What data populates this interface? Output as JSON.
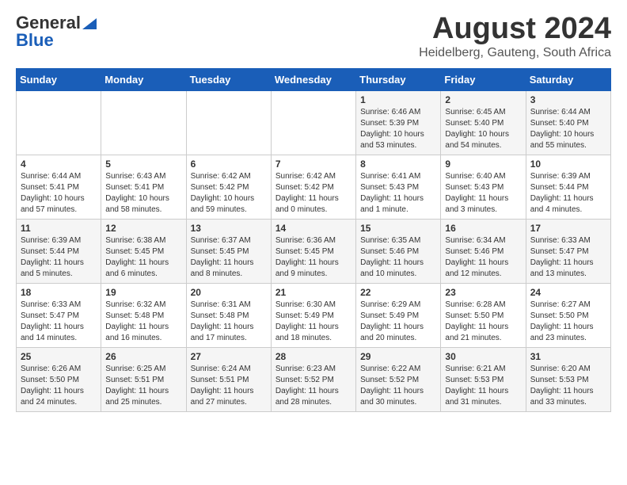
{
  "header": {
    "logo": {
      "general": "General",
      "blue": "Blue"
    },
    "title": "August 2024",
    "location": "Heidelberg, Gauteng, South Africa"
  },
  "calendar": {
    "days_header": [
      "Sunday",
      "Monday",
      "Tuesday",
      "Wednesday",
      "Thursday",
      "Friday",
      "Saturday"
    ],
    "weeks": [
      [
        {
          "day": "",
          "sunrise": "",
          "sunset": "",
          "daylight": ""
        },
        {
          "day": "",
          "sunrise": "",
          "sunset": "",
          "daylight": ""
        },
        {
          "day": "",
          "sunrise": "",
          "sunset": "",
          "daylight": ""
        },
        {
          "day": "",
          "sunrise": "",
          "sunset": "",
          "daylight": ""
        },
        {
          "day": "1",
          "sunrise": "Sunrise: 6:46 AM",
          "sunset": "Sunset: 5:39 PM",
          "daylight": "Daylight: 10 hours and 53 minutes."
        },
        {
          "day": "2",
          "sunrise": "Sunrise: 6:45 AM",
          "sunset": "Sunset: 5:40 PM",
          "daylight": "Daylight: 10 hours and 54 minutes."
        },
        {
          "day": "3",
          "sunrise": "Sunrise: 6:44 AM",
          "sunset": "Sunset: 5:40 PM",
          "daylight": "Daylight: 10 hours and 55 minutes."
        }
      ],
      [
        {
          "day": "4",
          "sunrise": "Sunrise: 6:44 AM",
          "sunset": "Sunset: 5:41 PM",
          "daylight": "Daylight: 10 hours and 57 minutes."
        },
        {
          "day": "5",
          "sunrise": "Sunrise: 6:43 AM",
          "sunset": "Sunset: 5:41 PM",
          "daylight": "Daylight: 10 hours and 58 minutes."
        },
        {
          "day": "6",
          "sunrise": "Sunrise: 6:42 AM",
          "sunset": "Sunset: 5:42 PM",
          "daylight": "Daylight: 10 hours and 59 minutes."
        },
        {
          "day": "7",
          "sunrise": "Sunrise: 6:42 AM",
          "sunset": "Sunset: 5:42 PM",
          "daylight": "Daylight: 11 hours and 0 minutes."
        },
        {
          "day": "8",
          "sunrise": "Sunrise: 6:41 AM",
          "sunset": "Sunset: 5:43 PM",
          "daylight": "Daylight: 11 hours and 1 minute."
        },
        {
          "day": "9",
          "sunrise": "Sunrise: 6:40 AM",
          "sunset": "Sunset: 5:43 PM",
          "daylight": "Daylight: 11 hours and 3 minutes."
        },
        {
          "day": "10",
          "sunrise": "Sunrise: 6:39 AM",
          "sunset": "Sunset: 5:44 PM",
          "daylight": "Daylight: 11 hours and 4 minutes."
        }
      ],
      [
        {
          "day": "11",
          "sunrise": "Sunrise: 6:39 AM",
          "sunset": "Sunset: 5:44 PM",
          "daylight": "Daylight: 11 hours and 5 minutes."
        },
        {
          "day": "12",
          "sunrise": "Sunrise: 6:38 AM",
          "sunset": "Sunset: 5:45 PM",
          "daylight": "Daylight: 11 hours and 6 minutes."
        },
        {
          "day": "13",
          "sunrise": "Sunrise: 6:37 AM",
          "sunset": "Sunset: 5:45 PM",
          "daylight": "Daylight: 11 hours and 8 minutes."
        },
        {
          "day": "14",
          "sunrise": "Sunrise: 6:36 AM",
          "sunset": "Sunset: 5:45 PM",
          "daylight": "Daylight: 11 hours and 9 minutes."
        },
        {
          "day": "15",
          "sunrise": "Sunrise: 6:35 AM",
          "sunset": "Sunset: 5:46 PM",
          "daylight": "Daylight: 11 hours and 10 minutes."
        },
        {
          "day": "16",
          "sunrise": "Sunrise: 6:34 AM",
          "sunset": "Sunset: 5:46 PM",
          "daylight": "Daylight: 11 hours and 12 minutes."
        },
        {
          "day": "17",
          "sunrise": "Sunrise: 6:33 AM",
          "sunset": "Sunset: 5:47 PM",
          "daylight": "Daylight: 11 hours and 13 minutes."
        }
      ],
      [
        {
          "day": "18",
          "sunrise": "Sunrise: 6:33 AM",
          "sunset": "Sunset: 5:47 PM",
          "daylight": "Daylight: 11 hours and 14 minutes."
        },
        {
          "day": "19",
          "sunrise": "Sunrise: 6:32 AM",
          "sunset": "Sunset: 5:48 PM",
          "daylight": "Daylight: 11 hours and 16 minutes."
        },
        {
          "day": "20",
          "sunrise": "Sunrise: 6:31 AM",
          "sunset": "Sunset: 5:48 PM",
          "daylight": "Daylight: 11 hours and 17 minutes."
        },
        {
          "day": "21",
          "sunrise": "Sunrise: 6:30 AM",
          "sunset": "Sunset: 5:49 PM",
          "daylight": "Daylight: 11 hours and 18 minutes."
        },
        {
          "day": "22",
          "sunrise": "Sunrise: 6:29 AM",
          "sunset": "Sunset: 5:49 PM",
          "daylight": "Daylight: 11 hours and 20 minutes."
        },
        {
          "day": "23",
          "sunrise": "Sunrise: 6:28 AM",
          "sunset": "Sunset: 5:50 PM",
          "daylight": "Daylight: 11 hours and 21 minutes."
        },
        {
          "day": "24",
          "sunrise": "Sunrise: 6:27 AM",
          "sunset": "Sunset: 5:50 PM",
          "daylight": "Daylight: 11 hours and 23 minutes."
        }
      ],
      [
        {
          "day": "25",
          "sunrise": "Sunrise: 6:26 AM",
          "sunset": "Sunset: 5:50 PM",
          "daylight": "Daylight: 11 hours and 24 minutes."
        },
        {
          "day": "26",
          "sunrise": "Sunrise: 6:25 AM",
          "sunset": "Sunset: 5:51 PM",
          "daylight": "Daylight: 11 hours and 25 minutes."
        },
        {
          "day": "27",
          "sunrise": "Sunrise: 6:24 AM",
          "sunset": "Sunset: 5:51 PM",
          "daylight": "Daylight: 11 hours and 27 minutes."
        },
        {
          "day": "28",
          "sunrise": "Sunrise: 6:23 AM",
          "sunset": "Sunset: 5:52 PM",
          "daylight": "Daylight: 11 hours and 28 minutes."
        },
        {
          "day": "29",
          "sunrise": "Sunrise: 6:22 AM",
          "sunset": "Sunset: 5:52 PM",
          "daylight": "Daylight: 11 hours and 30 minutes."
        },
        {
          "day": "30",
          "sunrise": "Sunrise: 6:21 AM",
          "sunset": "Sunset: 5:53 PM",
          "daylight": "Daylight: 11 hours and 31 minutes."
        },
        {
          "day": "31",
          "sunrise": "Sunrise: 6:20 AM",
          "sunset": "Sunset: 5:53 PM",
          "daylight": "Daylight: 11 hours and 33 minutes."
        }
      ]
    ]
  }
}
